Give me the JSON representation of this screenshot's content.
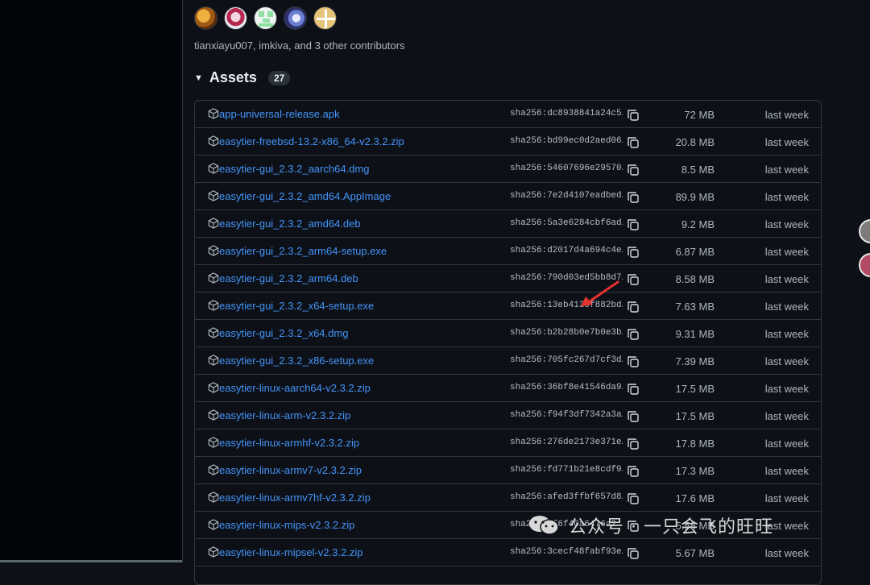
{
  "release": {
    "contributors_text": "tianxiayu007, imkiva, and 3 other contributors",
    "avatars": [
      "avatar-1",
      "avatar-2",
      "avatar-3",
      "avatar-4",
      "avatar-5"
    ]
  },
  "assets": {
    "title": "Assets",
    "count": "27",
    "expand_icon": "triangle-down-icon",
    "items": [
      {
        "name": "app-universal-release.apk",
        "sha": "sha256:dc8938841a24c5…",
        "size": "72 MB",
        "time": "last week"
      },
      {
        "name": "easytier-freebsd-13.2-x86_64-v2.3.2.zip",
        "sha": "sha256:bd99ec0d2aed06…",
        "size": "20.8 MB",
        "time": "last week"
      },
      {
        "name": "easytier-gui_2.3.2_aarch64.dmg",
        "sha": "sha256:54607696e29570…",
        "size": "8.5 MB",
        "time": "last week"
      },
      {
        "name": "easytier-gui_2.3.2_amd64.AppImage",
        "sha": "sha256:7e2d4107eadbed…",
        "size": "89.9 MB",
        "time": "last week"
      },
      {
        "name": "easytier-gui_2.3.2_amd64.deb",
        "sha": "sha256:5a3e6284cbf6ad…",
        "size": "9.2 MB",
        "time": "last week"
      },
      {
        "name": "easytier-gui_2.3.2_arm64-setup.exe",
        "sha": "sha256:d2017d4a694c4e…",
        "size": "6.87 MB",
        "time": "last week"
      },
      {
        "name": "easytier-gui_2.3.2_arm64.deb",
        "sha": "sha256:790d03ed5bb8d7…",
        "size": "8.58 MB",
        "time": "last week"
      },
      {
        "name": "easytier-gui_2.3.2_x64-setup.exe",
        "sha": "sha256:13eb4130f882bd…",
        "size": "7.63 MB",
        "time": "last week"
      },
      {
        "name": "easytier-gui_2.3.2_x64.dmg",
        "sha": "sha256:b2b28b0e7b0e3b…",
        "size": "9.31 MB",
        "time": "last week"
      },
      {
        "name": "easytier-gui_2.3.2_x86-setup.exe",
        "sha": "sha256:705fc267d7cf3d…",
        "size": "7.39 MB",
        "time": "last week"
      },
      {
        "name": "easytier-linux-aarch64-v2.3.2.zip",
        "sha": "sha256:36bf8e41546da9…",
        "size": "17.5 MB",
        "time": "last week"
      },
      {
        "name": "easytier-linux-arm-v2.3.2.zip",
        "sha": "sha256:f94f3df7342a3a…",
        "size": "17.5 MB",
        "time": "last week"
      },
      {
        "name": "easytier-linux-armhf-v2.3.2.zip",
        "sha": "sha256:276de2173e371e…",
        "size": "17.8 MB",
        "time": "last week"
      },
      {
        "name": "easytier-linux-armv7-v2.3.2.zip",
        "sha": "sha256:fd771b21e8cdf9…",
        "size": "17.3 MB",
        "time": "last week"
      },
      {
        "name": "easytier-linux-armv7hf-v2.3.2.zip",
        "sha": "sha256:afed3ffbf657d8…",
        "size": "17.6 MB",
        "time": "last week"
      },
      {
        "name": "easytier-linux-mips-v2.3.2.zip",
        "sha": "sha256:1f6f40a6476a2…",
        "size": "5.58 MB",
        "time": "last week"
      },
      {
        "name": "easytier-linux-mipsel-v2.3.2.zip",
        "sha": "sha256:3cecf48fabf93e…",
        "size": "5.67 MB",
        "time": "last week"
      }
    ]
  },
  "annotation": {
    "arrow_color": "#e5322d",
    "arrow_target": "easytier-gui_2.3.2_x64-setup.exe"
  },
  "watermark": {
    "text": "公众号 · 一只会飞的旺旺",
    "icon": "wechat-icon"
  },
  "colors": {
    "background": "#0d1117",
    "link": "#4493f8",
    "border": "#30363d",
    "muted": "#aeb6c0"
  }
}
